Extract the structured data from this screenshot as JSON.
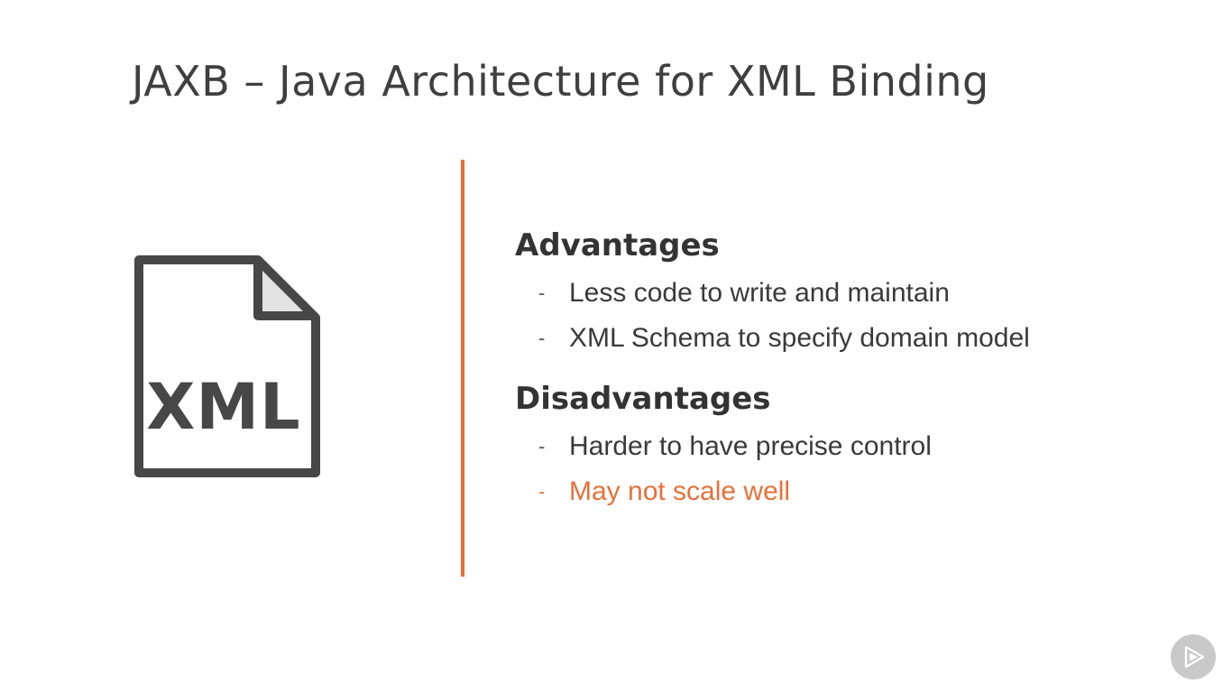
{
  "slide": {
    "title": "JAXB – Java Architecture for XML Binding",
    "icon": {
      "name": "xml-file-icon",
      "label": "XML"
    },
    "accent_color": "#e8703a",
    "advantages": {
      "heading": "Advantages",
      "items": [
        {
          "dash": "-",
          "text": "Less code to write and maintain"
        },
        {
          "dash": "-",
          "text": "XML Schema to specify domain model"
        }
      ]
    },
    "disadvantages": {
      "heading": "Disadvantages",
      "items": [
        {
          "dash": "-",
          "text": "Harder to have precise control"
        },
        {
          "dash": "-",
          "text": "May not scale well"
        }
      ]
    }
  },
  "player": {
    "icon": "play-logo-icon"
  }
}
